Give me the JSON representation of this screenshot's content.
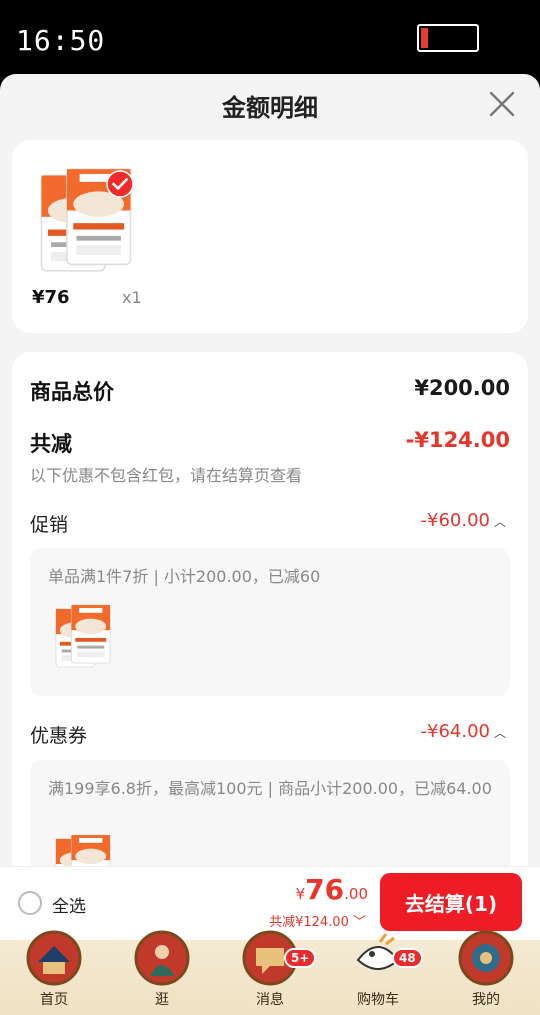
{
  "status": {
    "time": "16:50"
  },
  "sheet": {
    "title": "金额明细"
  },
  "product": {
    "price": "¥76",
    "qty": "x1"
  },
  "detail": {
    "total_label": "商品总价",
    "total_amount": "¥200.00",
    "reduce_label": "共减",
    "reduce_amount": "-¥124.00",
    "note": "以下优惠不包含红包，请在结算页查看",
    "promo_label": "促销",
    "promo_amount": "-¥60.00",
    "promo_desc": "单品满1件7折 | 小计200.00，已减60",
    "coupon_label": "优惠券",
    "coupon_amount": "-¥64.00",
    "coupon_desc": "满199享6.8折，最高减100元 | 商品小计200.00，已减64.00"
  },
  "bottom": {
    "select_all": "全选",
    "currency": "¥",
    "total_int": "76",
    "total_dec": ".00",
    "discount": "共减¥124.00",
    "checkout": "去结算(1)"
  },
  "tabs": [
    {
      "label": "首页",
      "badge": ""
    },
    {
      "label": "逛",
      "badge": ""
    },
    {
      "label": "消息",
      "badge": "5+"
    },
    {
      "label": "购物车",
      "badge": "48"
    },
    {
      "label": "我的",
      "badge": ""
    }
  ],
  "colors": {
    "accent": "#ee1c25",
    "price_red": "#e8352c",
    "tab_bg": "#f4ead3"
  }
}
